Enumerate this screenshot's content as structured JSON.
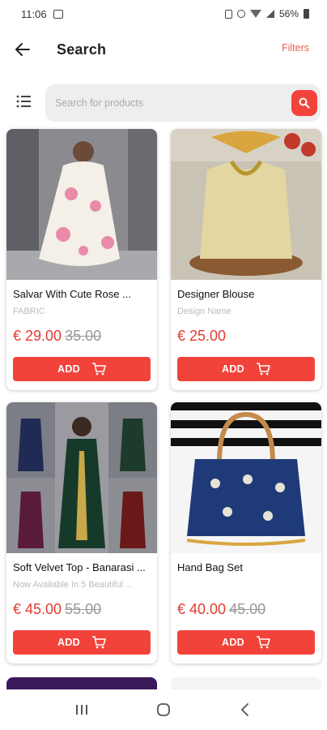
{
  "status_bar": {
    "time": "11:06",
    "battery": "56%"
  },
  "app_bar": {
    "title": "Search",
    "filters_label": "Filters"
  },
  "search": {
    "placeholder": "Search for products",
    "value": ""
  },
  "currency": "€",
  "accent_color": "#f2433a",
  "products": [
    {
      "title": "Salvar With Cute Rose ...",
      "subtitle": "FABRIC",
      "price": "€ 29.00",
      "old_price": "35.00",
      "add_label": "ADD"
    },
    {
      "title": "Designer Blouse",
      "subtitle": "Design Name",
      "price": "€ 25.00",
      "old_price": "",
      "add_label": "ADD"
    },
    {
      "title": "Soft Velvet Top -  Banarasi ...",
      "subtitle": "Now Available In 5 Beautiful ...",
      "price": "€ 45.00",
      "old_price": "55.00",
      "add_label": "ADD"
    },
    {
      "title": "Hand Bag Set",
      "subtitle": "",
      "price": "€ 40.00",
      "old_price": "45.00",
      "add_label": "ADD"
    }
  ]
}
